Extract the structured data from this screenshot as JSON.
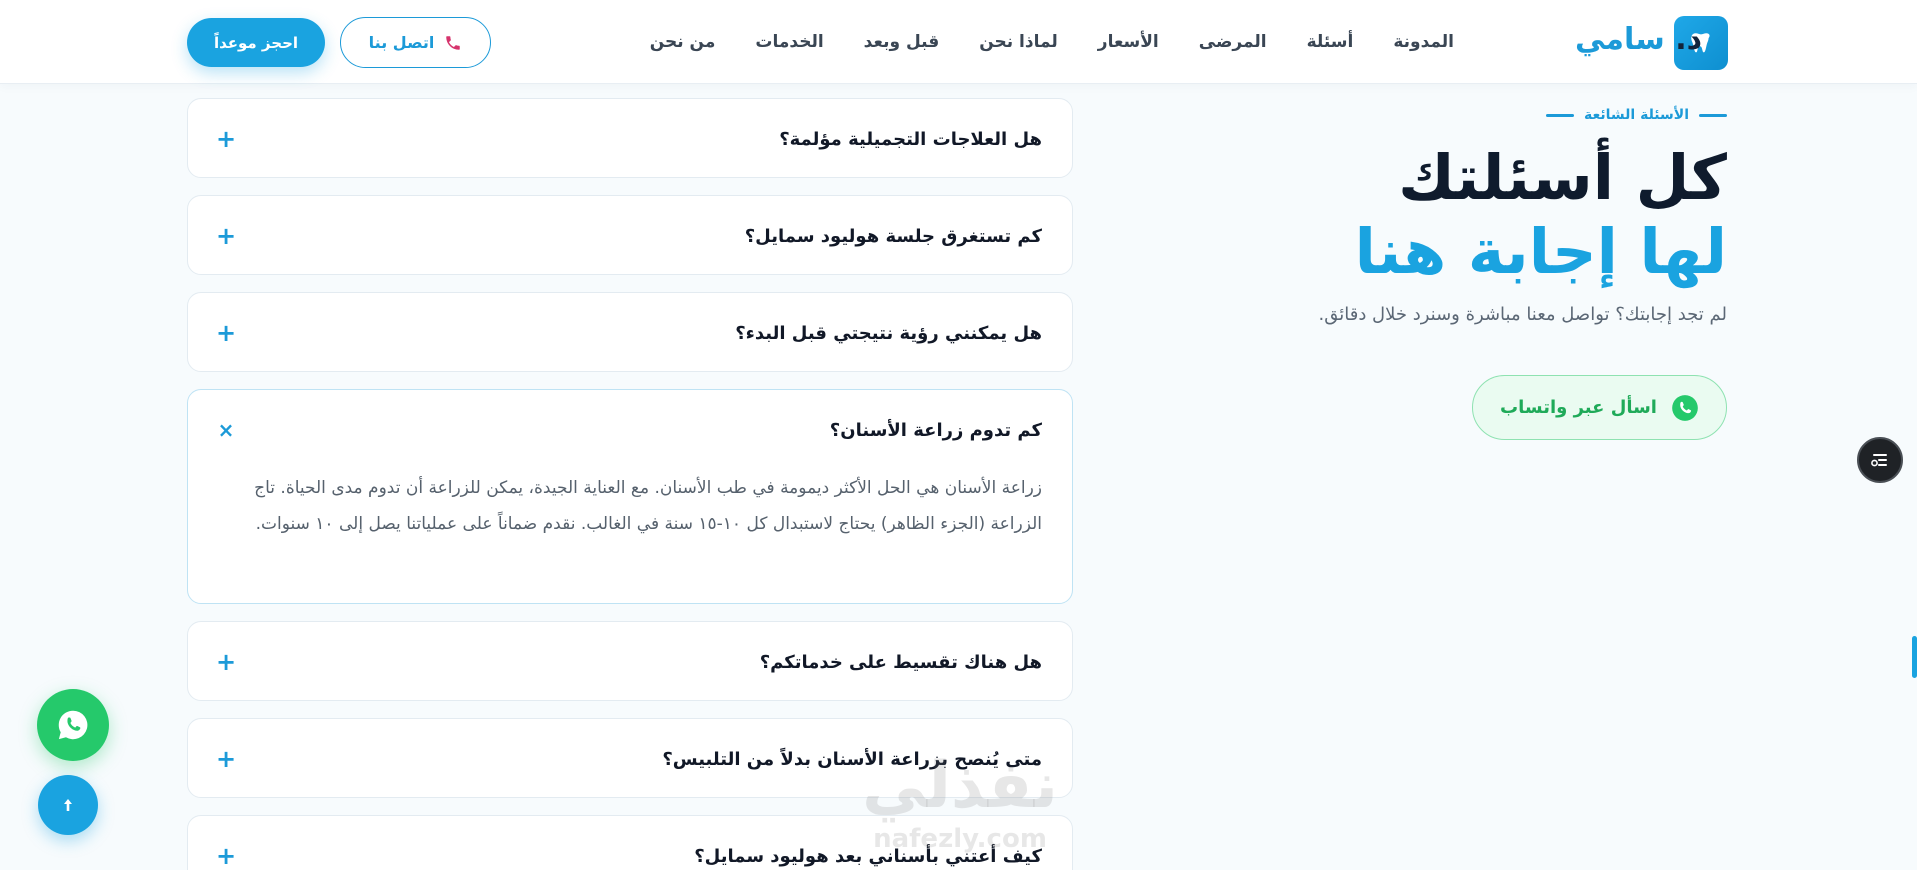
{
  "brand": {
    "prefix": "د.",
    "name": "سامي",
    "logo_icon": "tooth-icon"
  },
  "nav": {
    "items": [
      "من نحن",
      "الخدمات",
      "قبل وبعد",
      "لماذا نحن",
      "الأسعار",
      "المرضى",
      "أسئلة",
      "المدونة"
    ]
  },
  "header": {
    "contact_label": "اتصل بنا",
    "contact_icon": "phone-icon",
    "book_label": "احجز موعداً"
  },
  "intro": {
    "eyebrow": "الأسئلة الشائعة",
    "heading_line1": "كل أسئلتك",
    "heading_line2": "لها إجابة هنا",
    "lead": "لم تجد إجابتك؟ تواصل معنا مباشرة وسنرد خلال دقائق.",
    "whatsapp_label": "اسأل عبر واتساب",
    "whatsapp_icon": "whatsapp-icon"
  },
  "faq": {
    "items": [
      {
        "question": "هل العلاجات التجميلية مؤلمة؟",
        "toggle": "+"
      },
      {
        "question": "كم تستغرق جلسة هوليود سمايل؟",
        "toggle": "+"
      },
      {
        "question": "هل يمكنني رؤية نتيجتي قبل البدء؟",
        "toggle": "+"
      },
      {
        "question": "كم تدوم زراعة الأسنان؟",
        "toggle": "×",
        "answer": "زراعة الأسنان هي الحل الأكثر ديمومة في طب الأسنان. مع العناية الجيدة، يمكن للزراعة أن تدوم مدى الحياة. تاج الزراعة (الجزء الظاهر) يحتاج لاستبدال كل ١٠-١٥ سنة في الغالب. نقدم ضماناً على عملياتنا يصل إلى ١٠ سنوات."
      },
      {
        "question": "هل هناك تقسيط على خدماتكم؟",
        "toggle": "+"
      },
      {
        "question": "متى يُنصح بزراعة الأسنان بدلاً من التلبيس؟",
        "toggle": "+"
      },
      {
        "question": "كيف أعتني بأسناني بعد هوليود سمايل؟",
        "toggle": "+"
      }
    ]
  },
  "watermark": {
    "line1": "نفذلي",
    "line2": "nafezly.com"
  },
  "floating": {
    "whatsapp_icon": "whatsapp-icon",
    "back_to_top_icon": "arrow-up-icon",
    "accessibility_icon": "accessibility-icon"
  },
  "colors": {
    "accent": "#1aa3e0",
    "dark": "#0f1b2d",
    "whatsapp": "#25c96b",
    "phone_icon": "#d6336c"
  }
}
